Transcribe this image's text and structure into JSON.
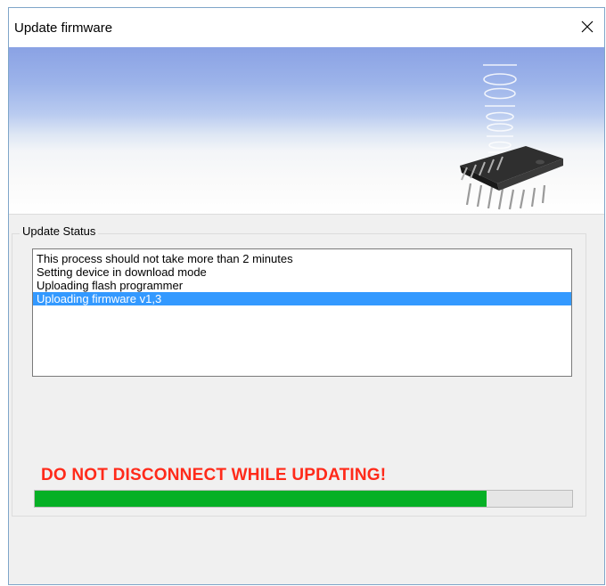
{
  "window": {
    "title": "Update firmware",
    "close_icon": "close-icon"
  },
  "banner": {
    "image": "firmware-chip-banner"
  },
  "update_status": {
    "group_label": "Update Status",
    "log": [
      {
        "text": "This process should not take more than 2 minutes",
        "selected": false
      },
      {
        "text": "Setting device in download mode",
        "selected": false
      },
      {
        "text": "Uploading flash programmer",
        "selected": false
      },
      {
        "text": "Uploading firmware v1,3",
        "selected": true
      }
    ],
    "warning": "DO NOT DISCONNECT WHILE UPDATING!",
    "progress": {
      "percent": 84
    }
  },
  "colors": {
    "warning": "#ff2a1a",
    "progress_fill": "#06b025",
    "selection": "#3399ff"
  }
}
